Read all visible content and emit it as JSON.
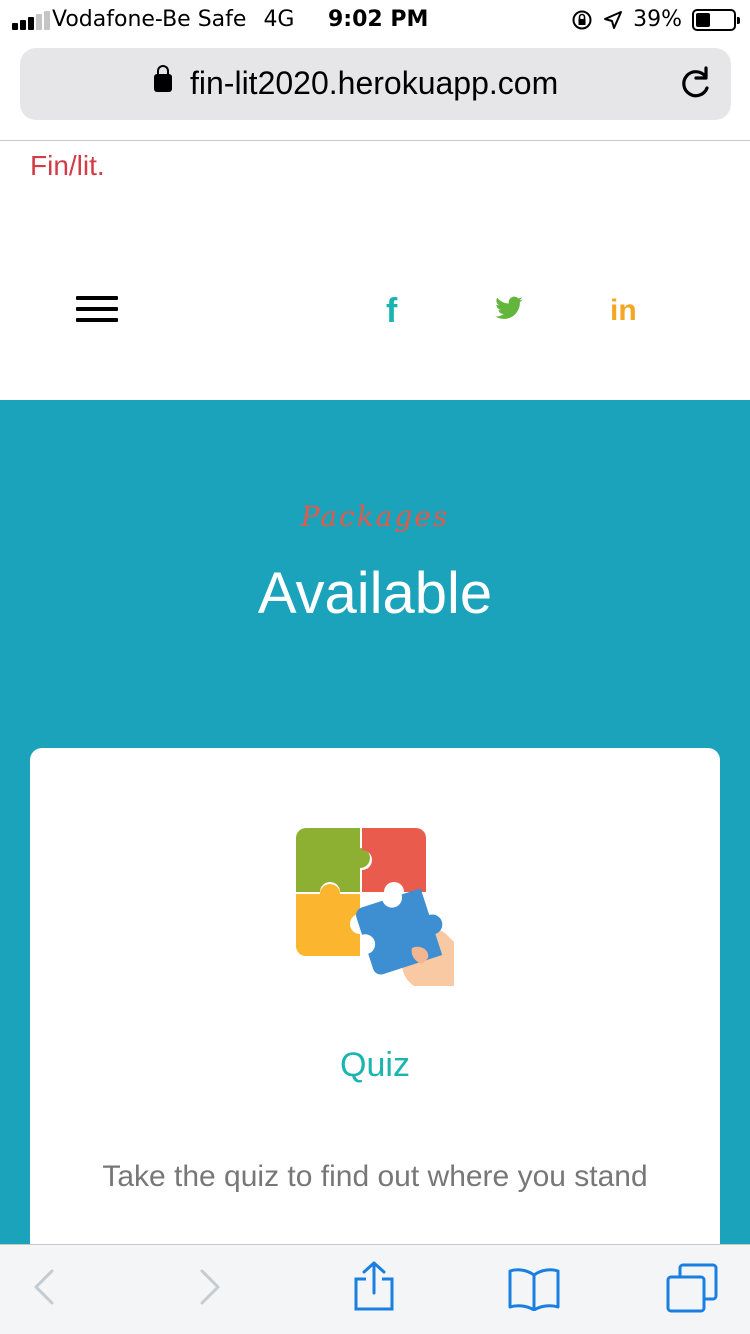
{
  "status_bar": {
    "carrier": "Vodafone-Be Safe",
    "network": "4G",
    "time": "9:02 PM",
    "battery_percent": "39%",
    "battery_level": 0.39,
    "signal_bars_on": 3,
    "signal_bars_total": 5,
    "icons": [
      "orientation-lock-icon",
      "location-arrow-icon",
      "battery-icon"
    ]
  },
  "browser": {
    "url": "fin-lit2020.herokuapp.com",
    "icons": [
      "lock-icon",
      "reload-icon"
    ]
  },
  "site": {
    "logo": "Fin/lit.",
    "social": {
      "facebook": "f",
      "linkedin": "in"
    }
  },
  "section": {
    "label": "Packages",
    "title": "Available"
  },
  "card": {
    "icon": "puzzle-icon",
    "title": "Quiz",
    "description": "Take the quiz to find out where you stand"
  },
  "toolbar": {
    "icons": [
      "back-icon",
      "forward-icon",
      "share-icon",
      "bookmarks-icon",
      "tabs-icon"
    ]
  },
  "colors": {
    "brand_red": "#d33b47",
    "teal_bg": "#1aa3ba",
    "accent_teal": "#1ab5b0",
    "twitter_green": "#62b63c",
    "linkedin_orange": "#f5a623"
  }
}
